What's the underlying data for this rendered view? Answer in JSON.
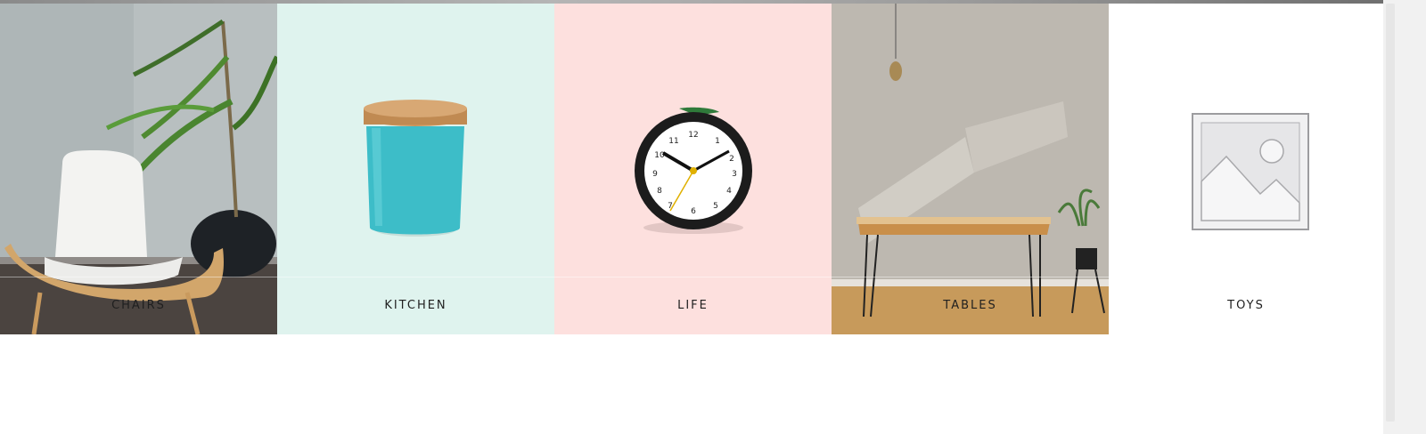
{
  "categories": [
    {
      "label": "CHAIRS",
      "background": "#b9c0c1",
      "image": "chair-plant-photo"
    },
    {
      "label": "KITCHEN",
      "background": "#dff3ee",
      "image": "teal-jar-icon"
    },
    {
      "label": "LIFE",
      "background": "#fde0de",
      "image": "alarm-clock-icon"
    },
    {
      "label": "TABLES",
      "background": "#c8c3bc",
      "image": "wooden-table-photo"
    },
    {
      "label": "TOYS",
      "background": "#ffffff",
      "image": "placeholder-image-icon"
    }
  ]
}
